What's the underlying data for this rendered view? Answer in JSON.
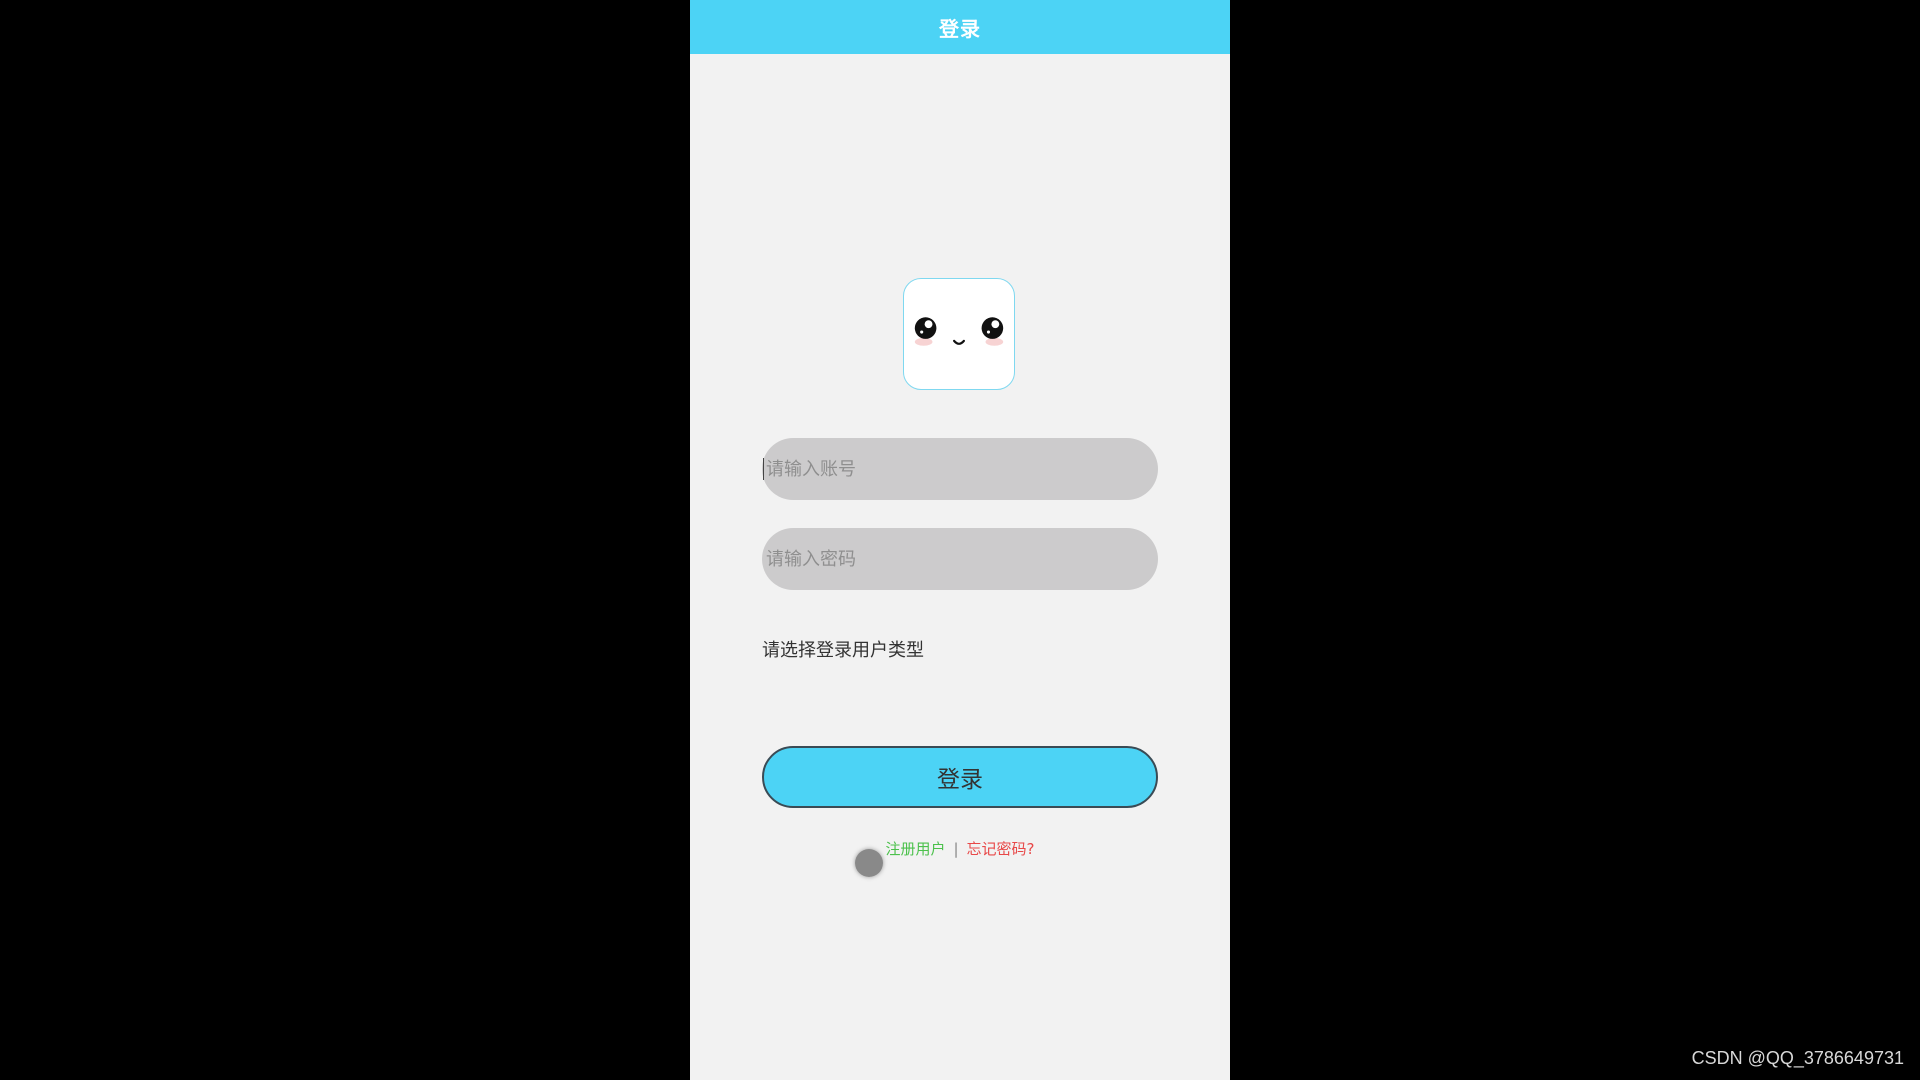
{
  "header": {
    "title": "登录"
  },
  "form": {
    "account_placeholder": "请输入账号",
    "password_placeholder": "请输入密码",
    "user_type_label": "请选择登录用户类型",
    "login_label": "登录"
  },
  "links": {
    "register": "注册用户",
    "separator": "|",
    "forgot": "忘记密码?"
  },
  "watermark": "CSDN @QQ_3786649731",
  "colors": {
    "accent": "#4cd3f5",
    "register": "#4cc14c",
    "forgot": "#e84848"
  },
  "icons": {
    "logo": "cute-face-icon"
  }
}
